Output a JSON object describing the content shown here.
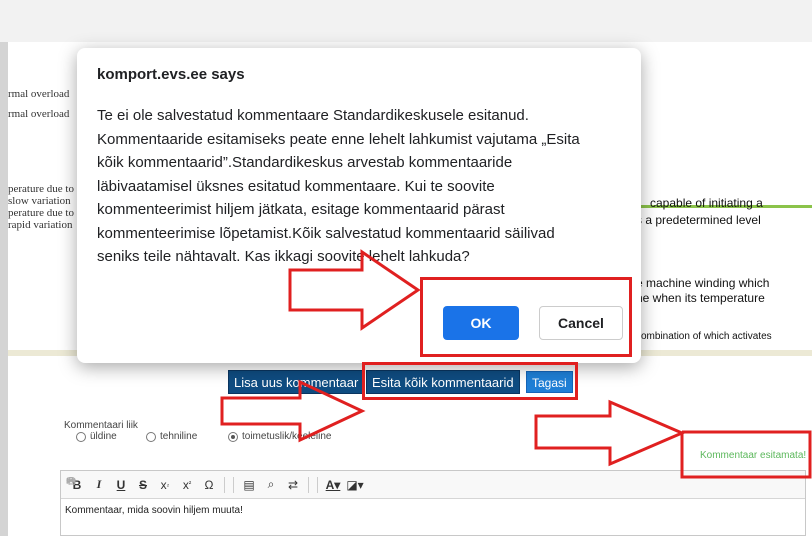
{
  "background_doc": {
    "left_lines": [
      "rmal overload",
      "rmal overload",
      "perature due to",
      "slow variation",
      "perature due to",
      "rapid variation"
    ],
    "right_lines": [
      "capable of initiating a",
      "s a predetermined level",
      "e machine winding which",
      "ne when its temperature",
      "combination of which activates"
    ]
  },
  "actions": {
    "add_comment": "Lisa uus kommentaar",
    "submit_all": "Esita kõik kommentaarid",
    "back": "Tagasi"
  },
  "comment_type": {
    "label": "Kommentaari liik",
    "options": [
      "üldine",
      "tehniline",
      "toimetuslik/keeleline"
    ],
    "selected": "toimetuslik/keeleline"
  },
  "status_text": "Kommentaar esitamata!",
  "editor": {
    "text": "Kommentaar, mida soovin hiljem muuta!",
    "toolbar_icons": [
      "bold-icon",
      "italic-icon",
      "underline-icon",
      "strikethrough-icon",
      "subscript-icon",
      "superscript-icon",
      "special-char-icon",
      "undo-icon",
      "redo-icon",
      "cut-icon",
      "copy-icon",
      "paste-icon",
      "find-icon",
      "replace-icon",
      "outdent-icon",
      "indent-icon",
      "text-color-icon",
      "bg-color-icon"
    ]
  },
  "dialog": {
    "title": "komport.evs.ee says",
    "message_lines": [
      "Te ei ole salvestatud kommentaare Standardikeskusele esitanud.",
      "Kommentaaride esitamiseks peate enne lehelt lahkumist vajutama „Esita",
      "kõik kommentaarid”.Standardikeskus arvestab kommentaaride",
      "läbivaatamisel üksnes esitatud kommentaare. Kui te soovite",
      "kommenteerimist hiljem jätkata, esitage kommentaarid pärast",
      "kommenteerimise lõpetamist.Kõik salvestatud kommentaarid säilivad",
      "seniks teile nähtavalt. Kas ikkagi soovite lehelt lahkuda?"
    ],
    "ok_label": "OK",
    "cancel_label": "Cancel"
  },
  "colors": {
    "annotation_red": "#e02020",
    "primary_blue": "#1a73e8",
    "dark_button": "#0f4c81",
    "status_green": "#5cb85c"
  }
}
